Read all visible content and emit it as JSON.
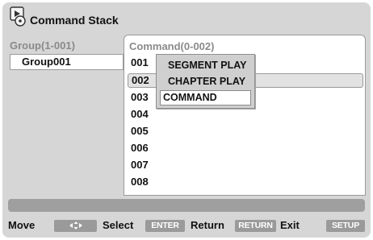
{
  "title": "Command Stack",
  "group_panel": {
    "header": "Group(1-001)",
    "items": [
      {
        "label": "Group001"
      }
    ]
  },
  "command_panel": {
    "header": "Command(0-002)",
    "rows": [
      {
        "label": "001"
      },
      {
        "label": "002",
        "selected": true
      },
      {
        "label": "003"
      },
      {
        "label": "004"
      },
      {
        "label": "005"
      },
      {
        "label": "006"
      },
      {
        "label": "007"
      },
      {
        "label": "008"
      }
    ]
  },
  "popup_menu": {
    "items": [
      {
        "label": "SEGMENT PLAY"
      },
      {
        "label": "CHAPTER PLAY"
      },
      {
        "label": "COMMAND",
        "selected": true
      }
    ]
  },
  "footer": {
    "move_label": "Move",
    "move_key_icon": "four-arrows-icon",
    "select_label": "Select",
    "select_key": "ENTER",
    "return_label": "Return",
    "return_key": "RETURN",
    "exit_label": "Exit",
    "exit_key": "SETUP"
  },
  "colors": {
    "background": "#d6d6d6",
    "panel": "#ffffff",
    "header_text": "#8a8a8a",
    "key_button": "#9a9a9a",
    "status_bar": "#9f9f9f"
  }
}
